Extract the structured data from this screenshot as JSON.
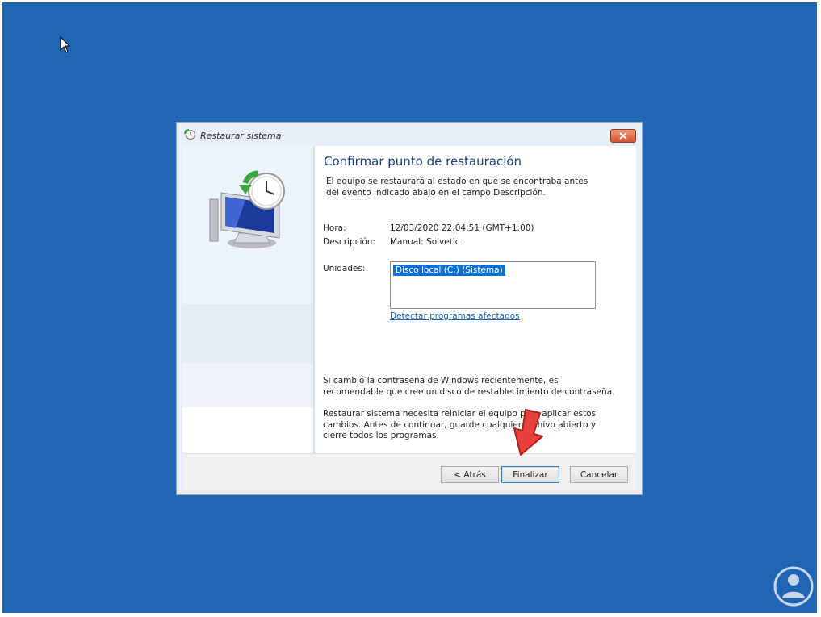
{
  "window": {
    "title": "Restaurar sistema",
    "heading": "Confirmar punto de restauración",
    "intro": "El equipo se restaurará al estado en que se encontraba antes del evento indicado abajo en el campo Descripción.",
    "fields": {
      "time_label": "Hora:",
      "time_value": "12/03/2020 22:04:51 (GMT+1:00)",
      "description_label": "Descripción:",
      "description_value": "Manual: Solvetic",
      "drives_label": "Unidades:"
    },
    "drives": [
      "Disco local (C:) (Sistema)"
    ],
    "detect_link": "Detectar programas afectados",
    "password_note": "Si cambió la contraseña de Windows recientemente, es recomendable que cree un disco de restablecimiento de contraseña.",
    "restart_note": "Restaurar sistema necesita reiniciar el equipo para aplicar estos cambios. Antes de continuar, guarde cualquier archivo abierto y cierre todos los programas.",
    "buttons": {
      "back": "< Atrás",
      "finish": "Finalizar",
      "cancel": "Cancelar"
    }
  },
  "colors": {
    "desktop": "#1f65b3",
    "heading": "#1d3f7a",
    "selection": "#0f6fd1",
    "link": "#1a64c4",
    "close_button": "#d2522e",
    "annotation_arrow": "#e8403a"
  },
  "icons": [
    "pointer-cursor-icon",
    "system-restore-icon",
    "close-icon",
    "restore-illustration-icon",
    "annotation-arrow-icon",
    "watermark-logo-icon"
  ]
}
